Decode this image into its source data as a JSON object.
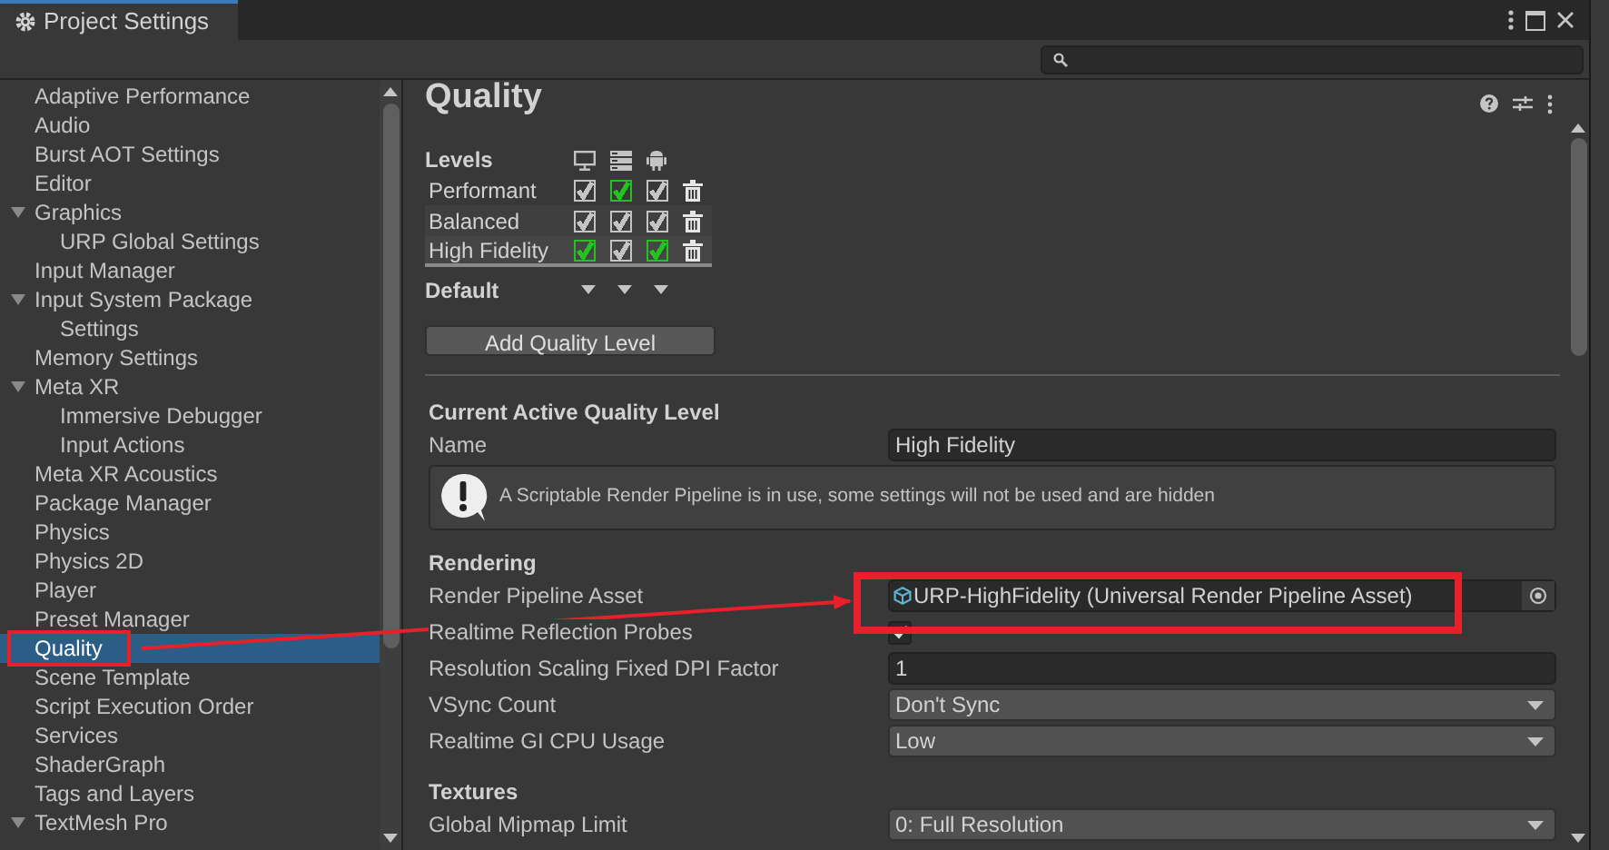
{
  "window": {
    "tab": "Project Settings"
  },
  "sidebar": {
    "items": [
      {
        "label": "Adaptive Performance",
        "selected": false
      },
      {
        "label": "Audio",
        "selected": false
      },
      {
        "label": "Burst AOT Settings",
        "selected": false
      },
      {
        "label": "Editor",
        "selected": false
      },
      {
        "label": "Graphics",
        "selected": false,
        "expanded": true,
        "children": [
          {
            "label": "URP Global Settings",
            "selected": false
          }
        ]
      },
      {
        "label": "Input Manager",
        "selected": false
      },
      {
        "label": "Input System Package",
        "selected": false,
        "expanded": true,
        "children": [
          {
            "label": "Settings",
            "selected": false
          }
        ]
      },
      {
        "label": "Memory Settings",
        "selected": false
      },
      {
        "label": "Meta XR",
        "selected": false,
        "expanded": true,
        "children": [
          {
            "label": "Immersive Debugger",
            "selected": false
          },
          {
            "label": "Input Actions",
            "selected": false
          }
        ]
      },
      {
        "label": "Meta XR Acoustics",
        "selected": false
      },
      {
        "label": "Package Manager",
        "selected": false
      },
      {
        "label": "Physics",
        "selected": false
      },
      {
        "label": "Physics 2D",
        "selected": false
      },
      {
        "label": "Player",
        "selected": false
      },
      {
        "label": "Preset Manager",
        "selected": false
      },
      {
        "label": "Quality",
        "selected": true
      },
      {
        "label": "Scene Template",
        "selected": false
      },
      {
        "label": "Script Execution Order",
        "selected": false
      },
      {
        "label": "Services",
        "selected": false
      },
      {
        "label": "ShaderGraph",
        "selected": false
      },
      {
        "label": "Tags and Layers",
        "selected": false
      },
      {
        "label": "TextMesh Pro",
        "selected": false,
        "expanded": true
      }
    ]
  },
  "page": {
    "title": "Quality",
    "levels": {
      "heading": "Levels",
      "rows": [
        {
          "name": "Performant",
          "selected": false,
          "platforms": [
            {
              "checked": true,
              "color": "#c4c4c4"
            },
            {
              "checked": true,
              "color": "#22c222"
            },
            {
              "checked": true,
              "color": "#c4c4c4"
            }
          ]
        },
        {
          "name": "Balanced",
          "selected": false,
          "platforms": [
            {
              "checked": true,
              "color": "#c4c4c4"
            },
            {
              "checked": true,
              "color": "#c4c4c4"
            },
            {
              "checked": true,
              "color": "#c4c4c4"
            }
          ]
        },
        {
          "name": "High Fidelity",
          "selected": true,
          "platforms": [
            {
              "checked": true,
              "color": "#22c222"
            },
            {
              "checked": true,
              "color": "#c4c4c4"
            },
            {
              "checked": true,
              "color": "#22c222"
            }
          ]
        }
      ],
      "default_label": "Default",
      "add_button": "Add Quality Level"
    },
    "sections": [
      {
        "heading": "Current Active Quality Level",
        "fields": [
          {
            "kind": "text",
            "label": "Name",
            "value": "High Fidelity"
          },
          {
            "kind": "help",
            "text": "A Scriptable Render Pipeline is in use, some settings will not be used and are hidden"
          }
        ]
      },
      {
        "heading": "Rendering",
        "fields": [
          {
            "kind": "object",
            "label": "Render Pipeline Asset",
            "value": "URP-HighFidelity (Universal Render Pipeline Asset)"
          },
          {
            "kind": "checkbox",
            "label": "Realtime Reflection Probes",
            "checked": true
          },
          {
            "kind": "text",
            "label": "Resolution Scaling Fixed DPI Factor",
            "value": "1"
          },
          {
            "kind": "dropdown",
            "label": "VSync Count",
            "value": "Don't Sync"
          },
          {
            "kind": "dropdown",
            "label": "Realtime GI CPU Usage",
            "value": "Low"
          }
        ]
      },
      {
        "heading": "Textures",
        "fields": [
          {
            "kind": "dropdown",
            "label": "Global Mipmap Limit",
            "value": "0: Full Resolution"
          }
        ]
      }
    ]
  }
}
